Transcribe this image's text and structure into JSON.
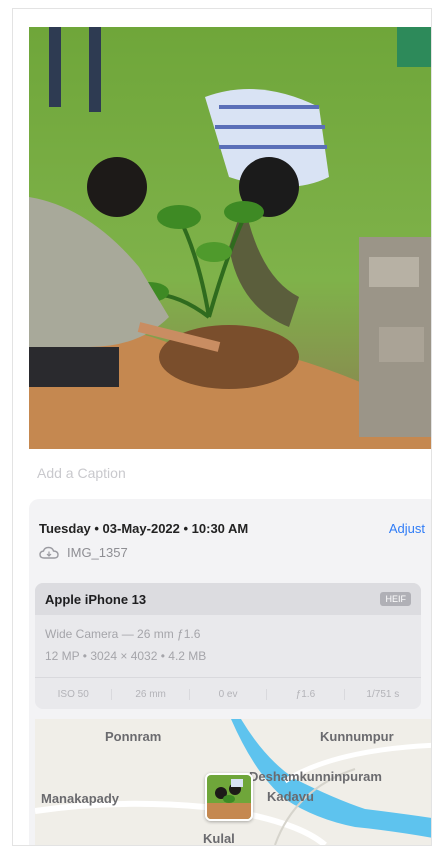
{
  "caption": {
    "placeholder": "Add a Caption"
  },
  "info": {
    "datetime": "Tuesday • 03-May-2022 • 10:30 AM",
    "adjust_label": "Adjust",
    "cloud_icon": "cloud-icon",
    "filename": "IMG_1357"
  },
  "camera": {
    "device": "Apple iPhone 13",
    "format_badge": "HEIF",
    "lens": "Wide Camera — 26 mm ƒ1.6",
    "specs": "12 MP • 3024 × 4032 • 4.2 MB",
    "exif": [
      "ISO 50",
      "26 mm",
      "0 ev",
      "ƒ1.6",
      "1/751 s"
    ]
  },
  "map": {
    "places": {
      "ponnram": "Ponnram",
      "kunnumpur": "Kunnumpur",
      "deshamkunninpuram": "Deshamkunninpuram",
      "kadavu": "Kadavu",
      "manakapady": "Manakapady",
      "kulal": "Kulal"
    }
  },
  "colors": {
    "accent": "#2f7cf6",
    "water": "#5ec3ee"
  }
}
